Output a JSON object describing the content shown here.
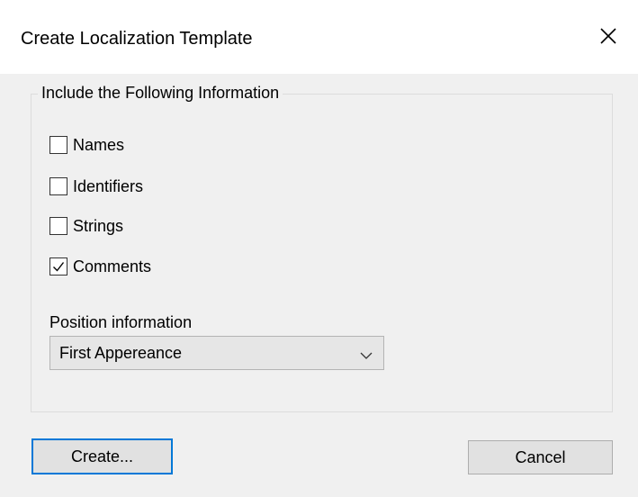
{
  "window": {
    "title": "Create Localization Template",
    "close_icon": "close-icon"
  },
  "group": {
    "label": "Include the Following Information",
    "checkboxes": [
      {
        "label": "Names",
        "checked": false
      },
      {
        "label": "Identifiers",
        "checked": false
      },
      {
        "label": "Strings",
        "checked": false
      },
      {
        "label": "Comments",
        "checked": true
      }
    ],
    "position": {
      "label": "Position information",
      "selected": "First Appereance"
    }
  },
  "buttons": {
    "create_label": "Create...",
    "cancel_label": "Cancel"
  },
  "colors": {
    "dialog_bg": "#f0f0f0",
    "titlebar_bg": "#ffffff",
    "focus_border": "#0078d7"
  }
}
